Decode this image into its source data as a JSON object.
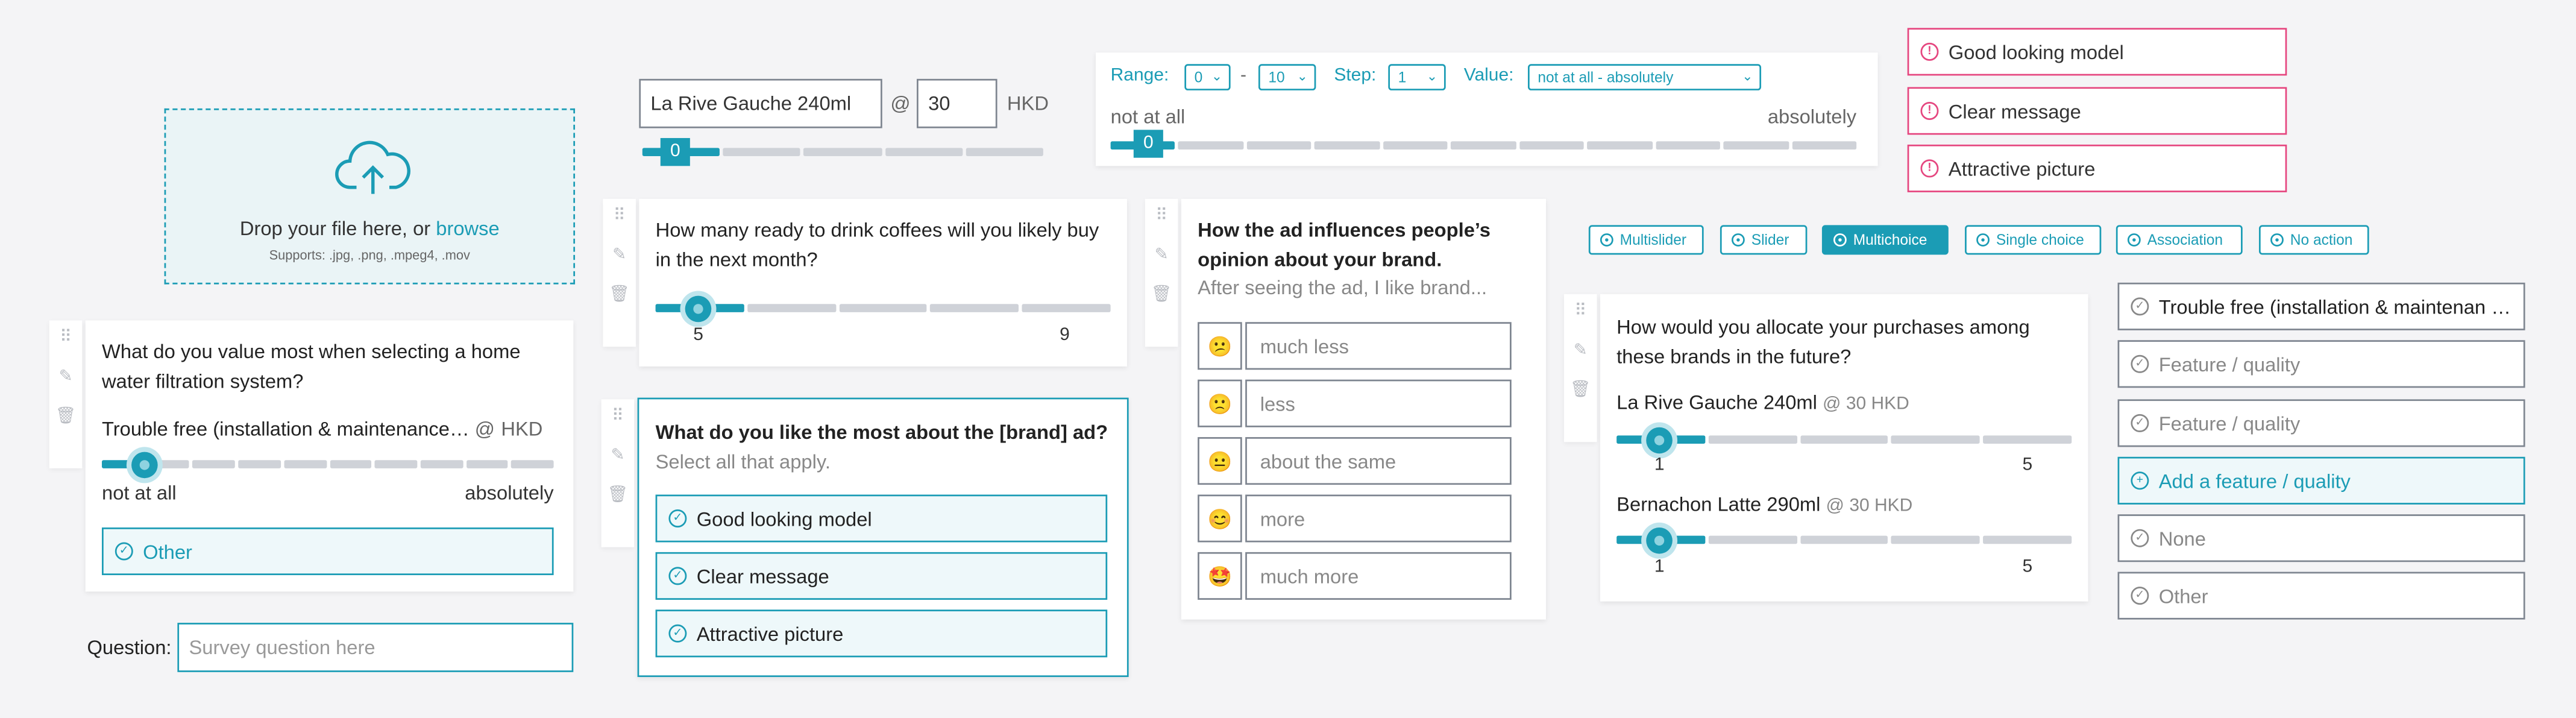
{
  "upload": {
    "drop_text": "Drop your file here, or ",
    "browse": "browse",
    "supports": "Supports: .jpg, .png, .mpeg4, .mov"
  },
  "product_price": {
    "product": "La Rive Gauche 240ml",
    "at": "@",
    "price": "30",
    "currency": "HKD",
    "slider_value": "0"
  },
  "range_config": {
    "range_label": "Range:",
    "range_from": "0",
    "dash": "-",
    "range_to": "10",
    "step_label": "Step:",
    "step": "1",
    "value_label": "Value:",
    "value": "not at all - absolutely",
    "min_label": "not at all",
    "max_label": "absolutely",
    "slider_value": "0"
  },
  "errors": [
    "Good looking model",
    "Clear message",
    "Attractive picture"
  ],
  "q_filter": {
    "question": "What do you value most when selecting a home water filtration system?",
    "option": "Trouble free (installation & maintenance…",
    "at": "@",
    "currency": "HKD",
    "min_label": "not at all",
    "max_label": "absolutely",
    "other": "Other"
  },
  "question_input": {
    "label": "Question:",
    "placeholder": "Survey question here"
  },
  "q_coffee": {
    "question": "How many ready to drink coffees will you likely buy in the next month?",
    "min": "5",
    "max": "9"
  },
  "q_brand_ad": {
    "question": "What do you like the most about the [brand] ad?",
    "instruction": "Select all that apply.",
    "options": [
      "Good looking model",
      "Clear message",
      "Attractive picture"
    ]
  },
  "q_influence": {
    "question": "How the ad influences people’s opinion about your brand.",
    "prompt": "After seeing the ad, I like brand...",
    "options": [
      {
        "emoji": "😕",
        "label": "much less"
      },
      {
        "emoji": "🙁",
        "label": "less"
      },
      {
        "emoji": "😐",
        "label": "about the same"
      },
      {
        "emoji": "😊",
        "label": "more"
      },
      {
        "emoji": "🤩",
        "label": "much more"
      }
    ]
  },
  "question_types": [
    "Multislider",
    "Slider",
    "Multichoice",
    "Single choice",
    "Association",
    "No action"
  ],
  "active_type": "Multichoice",
  "q_allocate": {
    "question": "How would you allocate your purchases among these brands in the future?",
    "items": [
      {
        "name": "La Rive Gauche 240ml",
        "price": "@ 30 HKD",
        "min": "1",
        "max": "5"
      },
      {
        "name": "Bernachon Latte 290ml",
        "price": "@ 30 HKD",
        "min": "1",
        "max": "5"
      }
    ]
  },
  "feature_list": [
    "Trouble free (installation & maintenan …",
    "Feature / quality",
    "Feature / quality",
    "Add a feature / quality",
    "None",
    "Other"
  ],
  "colors": {
    "accent": "#1b9cb5",
    "error": "#e5467f",
    "background": "#f4f4f6"
  },
  "icons": {
    "upload": "cloud-upload-icon",
    "drag": "drag-handle-icon",
    "edit": "pencil-icon",
    "delete": "trash-icon",
    "check": "check-circle-icon",
    "error": "exclamation-circle-icon",
    "add": "plus-circle-icon"
  }
}
